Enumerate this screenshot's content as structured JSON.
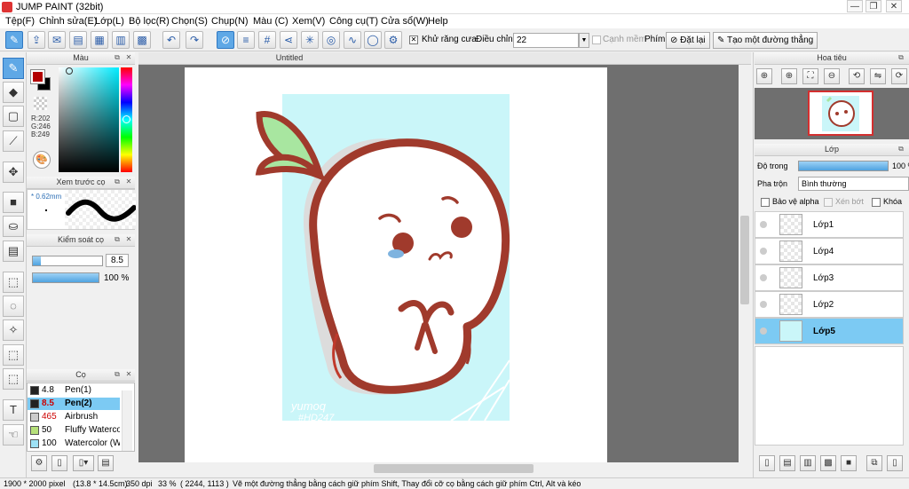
{
  "window": {
    "title": "JUMP PAINT (32bit)",
    "min": "—",
    "max": "❐",
    "close": "✕"
  },
  "menu": [
    "Tệp(F)",
    "Chỉnh sửa(E)",
    "Lớp(L)",
    "Bộ lọc(R)",
    "Chọn(S)",
    "Chụp(N)",
    "Màu (C)",
    "Xem(V)",
    "Công cụ(T)",
    "Cửa sổ(W)",
    "Help"
  ],
  "toolbar": {
    "antialias_label": "Khử răng cưa",
    "adjust_label": "Điều chỉnh",
    "adjust_value": "22",
    "smooth_label": "Cạnh mềm",
    "key_label": "Phím",
    "reset_label": "Đặt lại",
    "straight_label": "Tạo một đường thẳng"
  },
  "color_panel": {
    "title": "Màu",
    "r": "R:202",
    "g": "G:246",
    "b": "B:249"
  },
  "brush_preview": {
    "title": "Xem trước cọ",
    "size": "0.62mm"
  },
  "brush_control": {
    "title": "Kiểm soát cọ",
    "size_value": "8.5",
    "opacity_value": "100 %"
  },
  "brush_panel": {
    "title": "Cọ",
    "items": [
      {
        "size": "4.8",
        "name": "Pen(1)",
        "color": "#222222"
      },
      {
        "size": "8.5",
        "name": "Pen(2)",
        "color": "#222222",
        "selected": true
      },
      {
        "size": "465",
        "name": "Airbrush",
        "color": "#cccccc"
      },
      {
        "size": "50",
        "name": "Fluffy Watercol",
        "color": "#b6e07a"
      },
      {
        "size": "100",
        "name": "Watercolor (W",
        "color": "#9ee2f5"
      }
    ]
  },
  "document": {
    "tab_title": "Untitled"
  },
  "navigator": {
    "title": "Hoa tiêu"
  },
  "layers_panel": {
    "title": "Lớp",
    "opacity_label": "Độ trong",
    "opacity_value": "100 %",
    "blend_label": "Pha trộn",
    "blend_value": "Bình thường",
    "protect_alpha": "Bảo vệ alpha",
    "clip": "Xén bớt",
    "lock": "Khóa",
    "layers": [
      {
        "name": "Lớp1"
      },
      {
        "name": "Lớp4"
      },
      {
        "name": "Lớp3"
      },
      {
        "name": "Lớp2"
      },
      {
        "name": "Lớp5",
        "selected": true
      }
    ]
  },
  "status": {
    "size": "1900 * 2000 pixel",
    "cm": "(13.8 * 14.5cm)",
    "dpi": "350 dpi",
    "zoom": "33 %",
    "coords": "( 2244, 1113 )",
    "hint": "Vẽ một đường thẳng bằng cách giữ phím Shift, Thay đổi cỡ cọ bằng cách giữ phím Ctrl, Alt và kéo"
  },
  "artwork": {
    "signature_line1": "yumoq",
    "signature_line2": "#HD247",
    "bg_color": "#caf6f9",
    "outline_color": "#a03a2c",
    "leaf_color": "#a8e6a0"
  }
}
